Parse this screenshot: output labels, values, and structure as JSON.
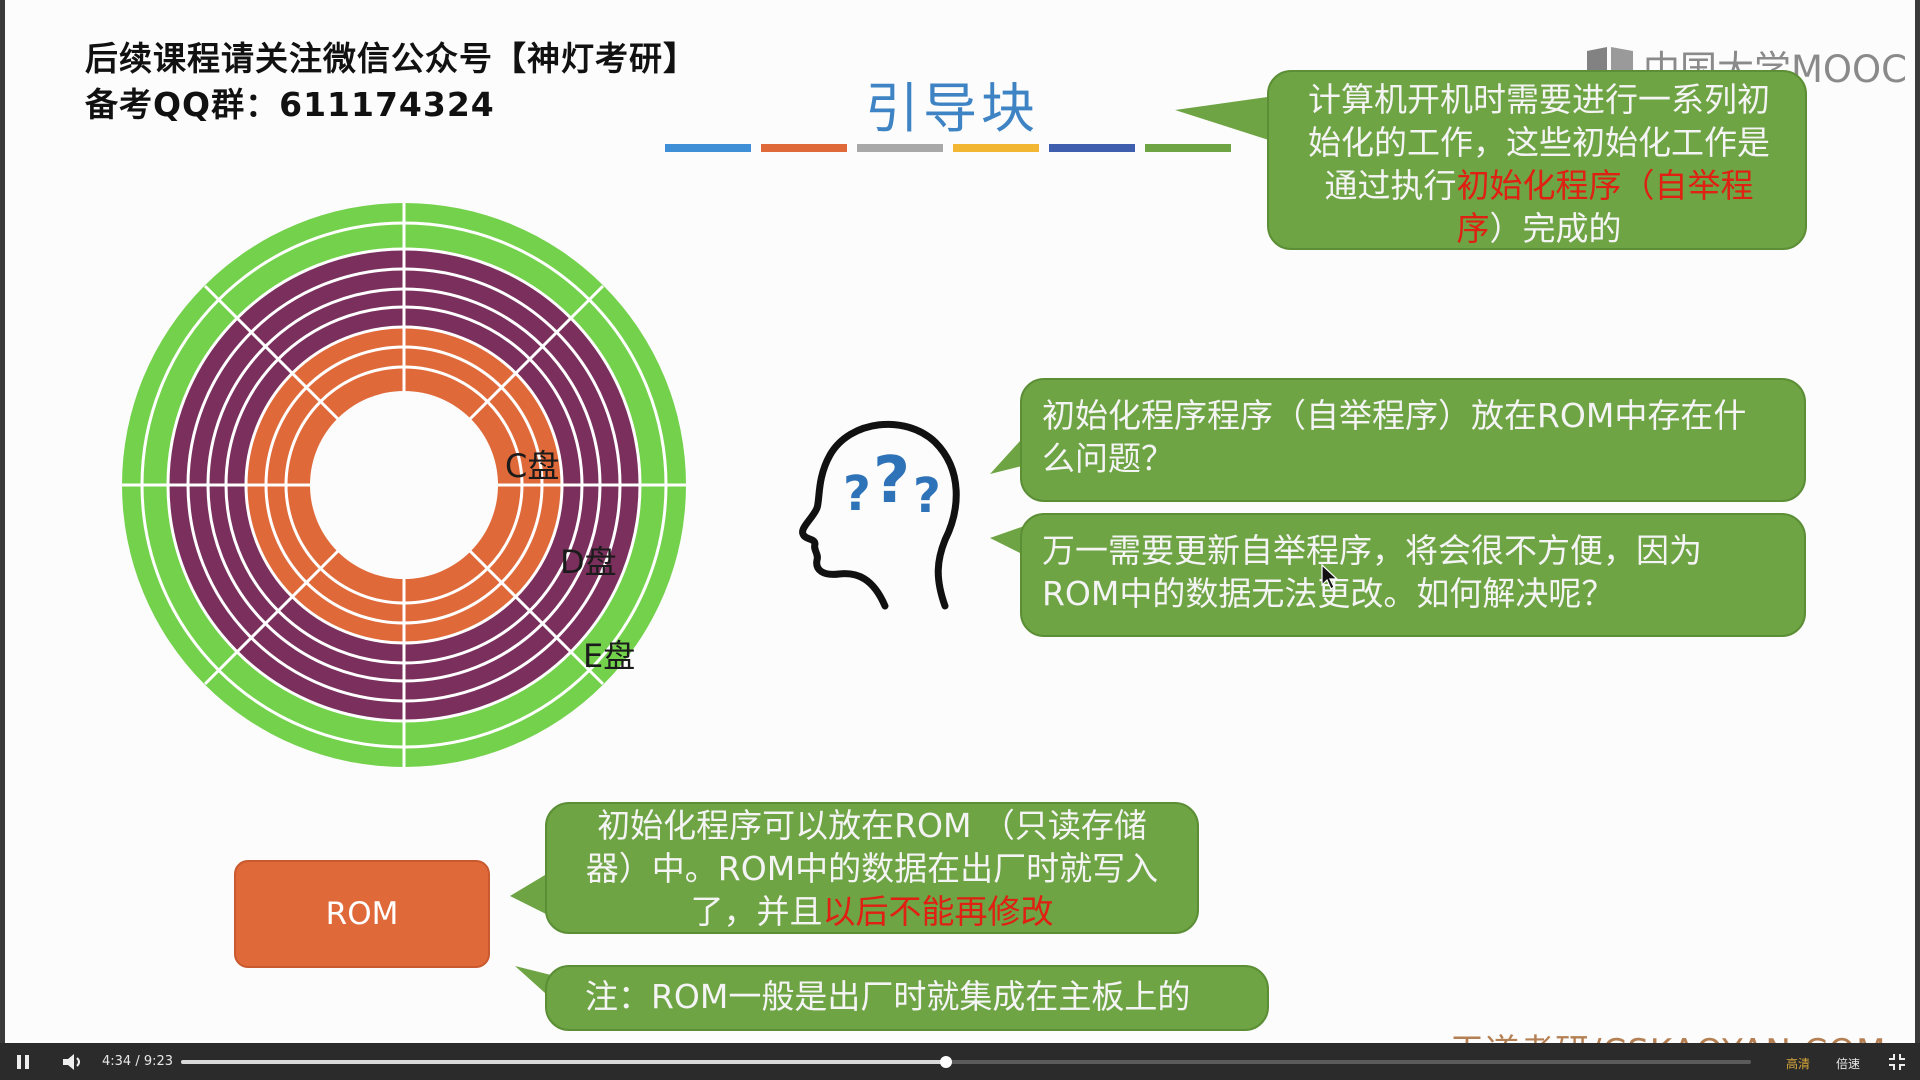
{
  "slide": {
    "top_note_line1": "后续课程请关注微信公众号【神灯考研】",
    "top_note_line2": "备考QQ群：611174324",
    "logo_text": "中国大学MOOC",
    "title": "引导块",
    "title_bar_colors": [
      "#3e8fd6",
      "#e0693a",
      "#a8a8a8",
      "#f2b632",
      "#3f5fae",
      "#6ea444"
    ],
    "disk": {
      "colors": {
        "outer": "#74d14c",
        "middle": "#7a2f5d",
        "inner": "#e0693a",
        "lines": "#ffffff"
      },
      "labels": [
        "C盘",
        "D盘",
        "E盘"
      ]
    },
    "bubble_top": {
      "text_a": "计算机开机时需要进行一系列初始化的工作，这些初始化工作是通过执行",
      "text_red": "初始化程序（自举程序",
      "text_b": "）完成的"
    },
    "bubble_question": "初始化程序程序（自举程序）放在ROM中存在什么问题？",
    "bubble_answer": "万一需要更新自举程序，将会很不方便，因为ROM中的数据无法更改。如何解决呢？",
    "rom_label": "ROM",
    "bubble_rom": {
      "text_a": "初始化程序可以放在ROM （只读存储器）中。ROM中的数据在出厂时就写入了，并且",
      "text_red": "以后不能再修改"
    },
    "bubble_note": "注：ROM一般是出厂时就集成在主板上的",
    "watermark": "王道考研/CSKAOYAN.COM"
  },
  "player": {
    "time_current": "4:34",
    "time_total": "9:23",
    "time_separator": "/",
    "progress": 0.487,
    "quality_label": "高清",
    "speed_label": "倍速"
  },
  "icons": [
    "pause-icon",
    "volume-icon",
    "fullscreen-exit-icon",
    "head-question-icon",
    "mooc-book-icon",
    "mouse-cursor-icon"
  ]
}
